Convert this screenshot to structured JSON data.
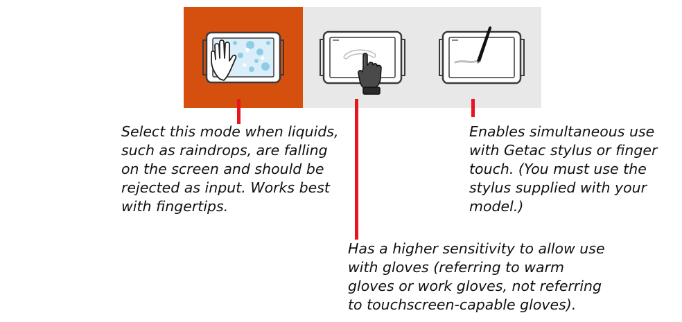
{
  "modes": [
    {
      "key": "water",
      "active": true,
      "description_lines": [
        "Select this mode when liquids,",
        "such as raindrops, are falling",
        "on the screen and should be",
        "rejected as input. Works best",
        "with fingertips."
      ]
    },
    {
      "key": "glove",
      "active": false,
      "description_lines": [
        "Has a higher sensitivity to allow use",
        "with gloves (referring to warm",
        "gloves or work gloves, not referring",
        "to touchscreen-capable gloves)."
      ]
    },
    {
      "key": "pen",
      "active": false,
      "description_lines": [
        "Enables simultaneous use",
        "with Getac stylus or finger",
        "touch. (You must use the",
        "stylus supplied with your",
        "model.)"
      ]
    }
  ],
  "colors": {
    "active_tile": "#d5500f",
    "inactive_tile": "#e8e8e8",
    "connector": "#e8141e",
    "text": "#111111"
  },
  "icons": [
    "tablet-wet-hand-icon",
    "tablet-glove-hand-icon",
    "tablet-stylus-icon"
  ]
}
